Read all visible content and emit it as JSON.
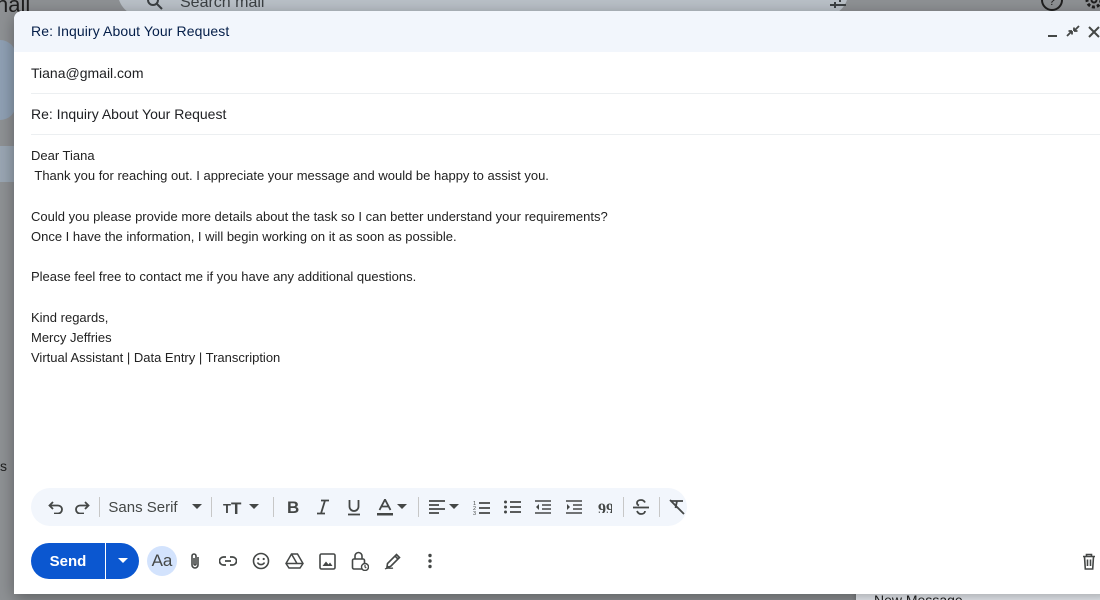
{
  "background": {
    "app_name": "nail",
    "search_placeholder": "Search mail",
    "sidebar_fragment": "s",
    "new_message_tab": "New Message",
    "icons": [
      "search-icon",
      "filter-icon",
      "help-icon",
      "gear-icon"
    ]
  },
  "compose": {
    "title": "Re: Inquiry About Your Request",
    "header_icons": [
      "minimize-icon",
      "exit-full-screen-icon",
      "close-icon"
    ],
    "to": "Tiana@gmail.com",
    "subject": "Re: Inquiry About Your Request",
    "body_lines": [
      "Dear Tiana",
      " Thank you for reaching out. I appreciate your message and would be happy to assist you.",
      "",
      "Could you please provide more details about the task so I can better understand your requirements?",
      "Once I have the information, I will begin working on it as soon as possible.",
      "",
      "Please feel free to contact me if you have any additional questions.",
      "",
      "Kind regards,",
      "Mercy Jeffries",
      "Virtual Assistant | Data Entry | Transcription"
    ],
    "toolbar": {
      "font_family": "Sans Serif",
      "icons": [
        "undo-icon",
        "redo-icon",
        "font-size-icon",
        "bold-icon",
        "italic-icon",
        "underline-icon",
        "text-color-icon",
        "align-icon",
        "numbered-list-icon",
        "bulleted-list-icon",
        "indent-less-icon",
        "indent-more-icon",
        "quote-icon",
        "strikethrough-icon",
        "remove-formatting-icon"
      ]
    },
    "actions": {
      "send_label": "Send",
      "formatting_label": "Aa",
      "icons": [
        "attach-icon",
        "link-icon",
        "emoji-icon",
        "drive-icon",
        "photo-icon",
        "confidential-mode-icon",
        "signature-icon",
        "more-options-icon",
        "discard-icon"
      ]
    },
    "colors": {
      "send_button": "#0b57d0",
      "header_bg": "#f2f6fc",
      "toolbar_bg": "#f2f6fc",
      "aa_active_bg": "#d3e3fd"
    }
  }
}
